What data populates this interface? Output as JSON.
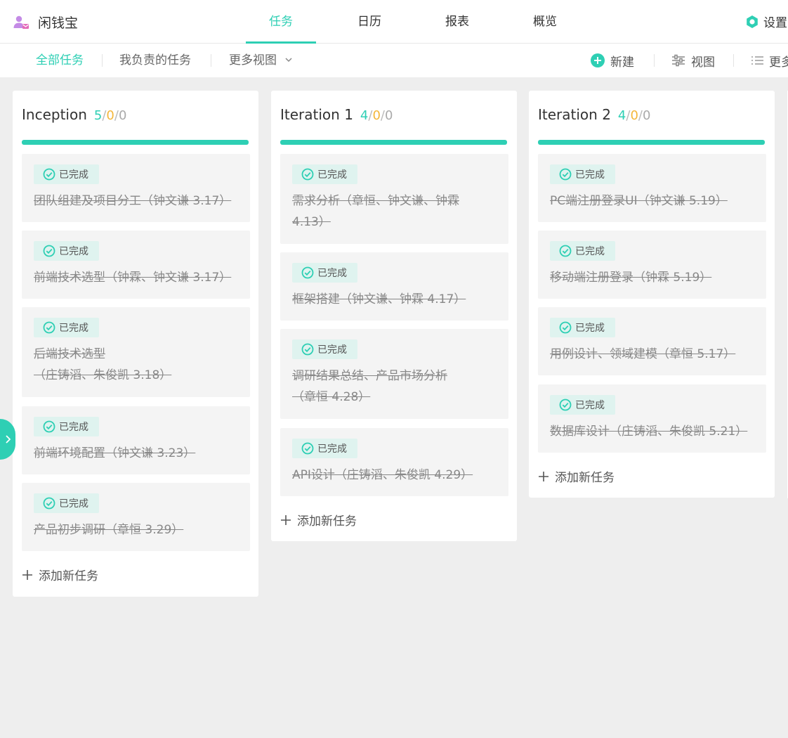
{
  "app": {
    "name": "闲钱宝",
    "icon": "user-icon"
  },
  "nav": {
    "tabs": [
      "任务",
      "日历",
      "报表",
      "概览"
    ],
    "active": 0,
    "settings": "设置"
  },
  "views": {
    "all": "全部任务",
    "mine": "我负责的任务",
    "more": "更多视图"
  },
  "toolbar": {
    "new": "新建",
    "view": "视图",
    "more": "更多"
  },
  "accent": "#2ecfb4",
  "columns": [
    {
      "title": "Inception",
      "done": "5",
      "in_progress": "0",
      "todo": "0",
      "cards": [
        {
          "status": "已完成",
          "lines": [
            "团队组建及项目分工（钟文谦 3.17）"
          ]
        },
        {
          "status": "已完成",
          "lines": [
            "前端技术选型（钟霖、钟文谦 3.17）"
          ]
        },
        {
          "status": "已完成",
          "lines": [
            "后端技术选型",
            "（庄铸滔、朱俊凯 3.18）"
          ]
        },
        {
          "status": "已完成",
          "lines": [
            "前端环境配置（钟文谦 3.23）"
          ]
        },
        {
          "status": "已完成",
          "lines": [
            "产品初步调研（章恒 3.29）"
          ]
        }
      ],
      "add_label": "添加新任务"
    },
    {
      "title": "Iteration 1",
      "done": "4",
      "in_progress": "0",
      "todo": "0",
      "cards": [
        {
          "status": "已完成",
          "lines": [
            "需求分析（章恒、钟文谦、钟霖",
            "4.13）"
          ]
        },
        {
          "status": "已完成",
          "lines": [
            "框架搭建（钟文谦、钟霖 4.17）"
          ]
        },
        {
          "status": "已完成",
          "lines": [
            "调研结果总结、产品市场分析",
            "（章恒 4.28）"
          ]
        },
        {
          "status": "已完成",
          "lines": [
            "API设计（庄铸滔、朱俊凯 4.29）"
          ]
        }
      ],
      "add_label": "添加新任务"
    },
    {
      "title": "Iteration 2",
      "done": "4",
      "in_progress": "0",
      "todo": "0",
      "cards": [
        {
          "status": "已完成",
          "lines": [
            "PC端注册登录UI（钟文谦 5.19）"
          ]
        },
        {
          "status": "已完成",
          "lines": [
            "移动端注册登录（钟霖 5.19）"
          ]
        },
        {
          "status": "已完成",
          "lines": [
            "用例设计、领域建模（章恒 5.17）"
          ]
        },
        {
          "status": "已完成",
          "lines": [
            "数据库设计（庄铸滔、朱俊凯 5.21）"
          ]
        }
      ],
      "add_label": "添加新任务"
    }
  ]
}
